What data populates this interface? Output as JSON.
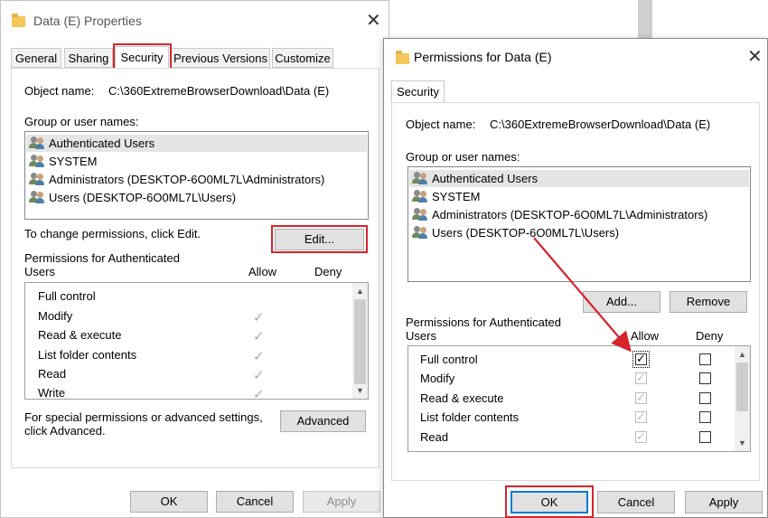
{
  "left_dialog": {
    "title": "Data (E) Properties",
    "tabs": [
      "General",
      "Sharing",
      "Security",
      "Previous Versions",
      "Customize"
    ],
    "object_name_label": "Object name:",
    "object_name_value": "C:\\360ExtremeBrowserDownload\\Data (E)",
    "group_label": "Group or user names:",
    "users": [
      "Authenticated Users",
      "SYSTEM",
      "Administrators (DESKTOP-6O0ML7L\\Administrators)",
      "Users (DESKTOP-6O0ML7L\\Users)"
    ],
    "change_text": "To change permissions, click Edit.",
    "edit_label": "Edit...",
    "perm_header_line1": "Permissions for Authenticated",
    "perm_header_line2": "Users",
    "allow_label": "Allow",
    "deny_label": "Deny",
    "permissions": [
      "Full control",
      "Modify",
      "Read & execute",
      "List folder contents",
      "Read",
      "Write"
    ],
    "special_line1": "For special permissions or advanced settings,",
    "special_line2": "click Advanced.",
    "advanced_label": "Advanced",
    "ok_label": "OK",
    "cancel_label": "Cancel",
    "apply_label": "Apply"
  },
  "right_dialog": {
    "title": "Permissions for Data (E)",
    "tab": "Security",
    "object_name_label": "Object name:",
    "object_name_value": "C:\\360ExtremeBrowserDownload\\Data (E)",
    "group_label": "Group or user names:",
    "users": [
      "Authenticated Users",
      "SYSTEM",
      "Administrators (DESKTOP-6O0ML7L\\Administrators)",
      "Users (DESKTOP-6O0ML7L\\Users)"
    ],
    "add_label": "Add...",
    "remove_label": "Remove",
    "perm_header_line1": "Permissions for Authenticated",
    "perm_header_line2": "Users",
    "allow_label": "Allow",
    "deny_label": "Deny",
    "permissions": [
      "Full control",
      "Modify",
      "Read & execute",
      "List folder contents",
      "Read"
    ],
    "ok_label": "OK",
    "cancel_label": "Cancel",
    "apply_label": "Apply"
  },
  "colors": {
    "highlight_red": "#d6232c",
    "focus_blue": "#0078d7",
    "arrow_red": "#d6232c"
  }
}
